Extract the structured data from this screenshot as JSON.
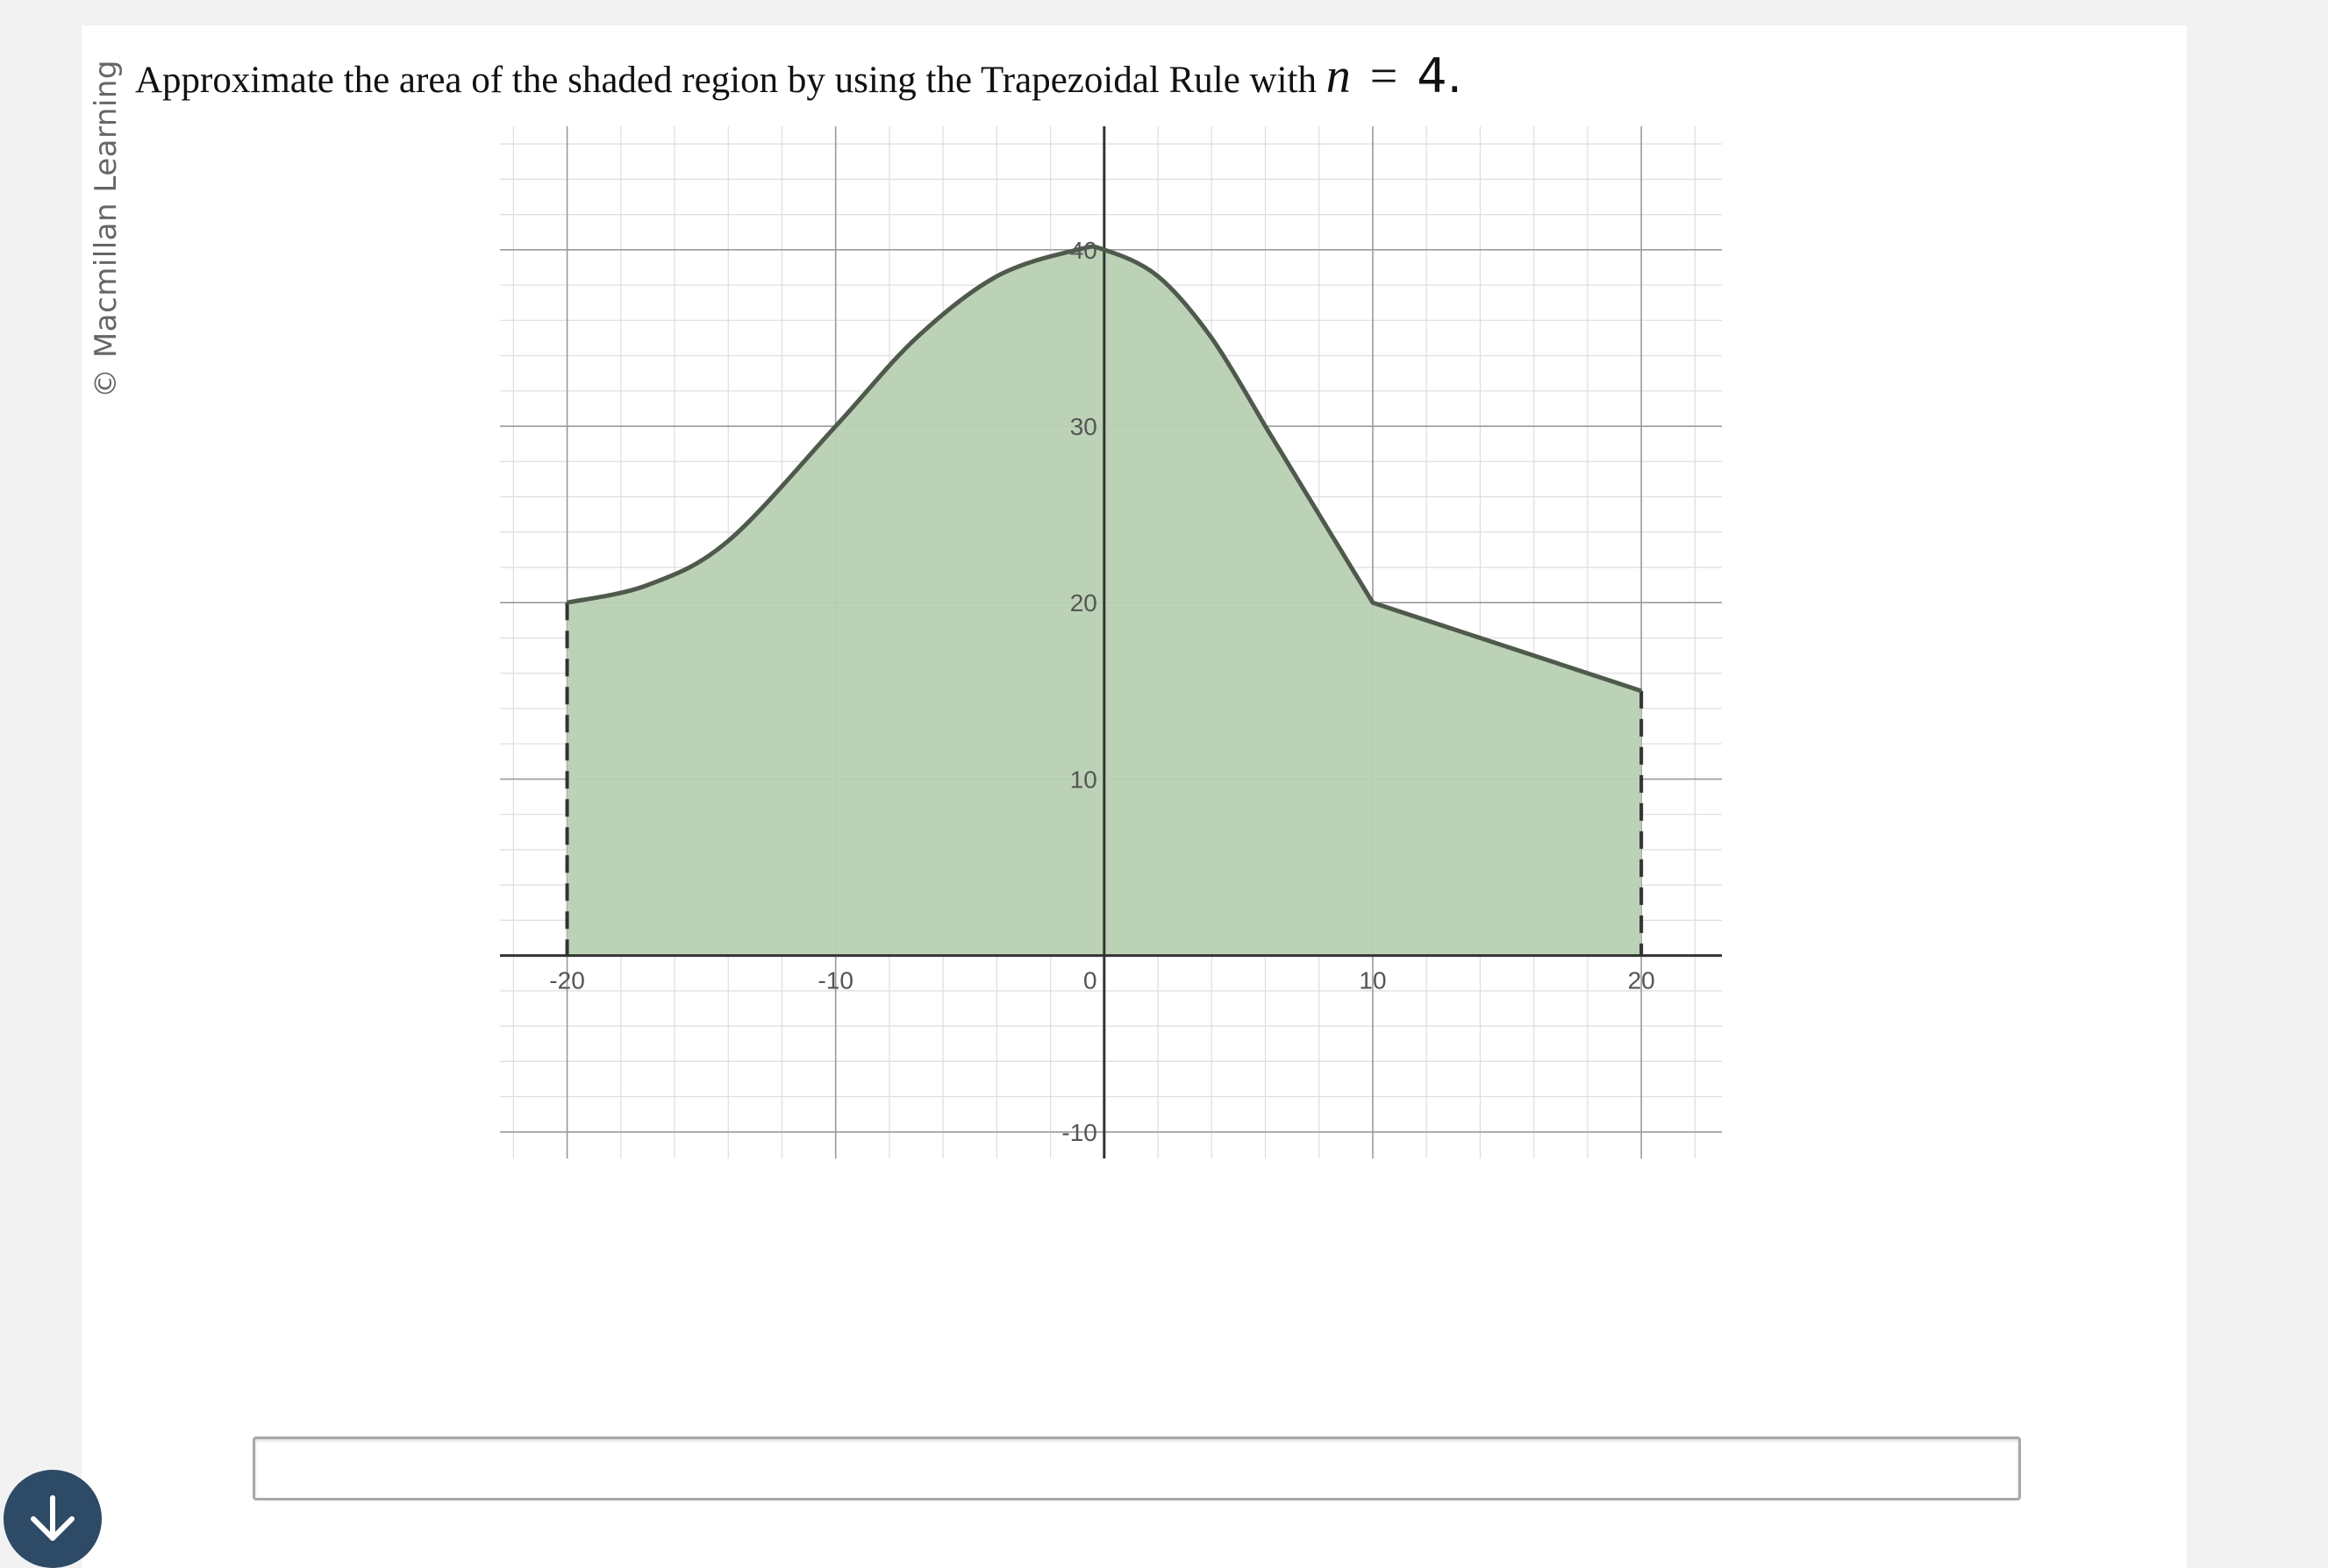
{
  "watermark": "© Macmillan Learning",
  "question": {
    "text": "Approximate the area of the shaded region by using the Trapezoidal Rule with",
    "variable": "n",
    "equals": "=",
    "value": "4."
  },
  "answer": {
    "value": "",
    "placeholder": ""
  },
  "scroll_button_icon": "arrow-down-icon",
  "colors": {
    "fill": "#b8d0b2",
    "curve": "#4f5a4d",
    "scroll_button": "#2d4a66"
  },
  "chart_data": {
    "type": "area",
    "xlim": [
      -22.5,
      23
    ],
    "ylim": [
      -11.5,
      47
    ],
    "grid": true,
    "x_ticks": [
      -20,
      -10,
      0,
      10,
      20
    ],
    "x_tick_labels": [
      "-20",
      "-10",
      "0",
      "10",
      "20"
    ],
    "y_ticks": [
      -10,
      10,
      20,
      30,
      40
    ],
    "y_tick_labels": [
      "-10",
      "10",
      "20",
      "30",
      "40"
    ],
    "curve": [
      {
        "x": -20,
        "y": 20
      },
      {
        "x": -17,
        "y": 21
      },
      {
        "x": -14,
        "y": 23.5
      },
      {
        "x": -10,
        "y": 30
      },
      {
        "x": -7,
        "y": 35
      },
      {
        "x": -4,
        "y": 38.5
      },
      {
        "x": -1,
        "y": 40
      },
      {
        "x": 0,
        "y": 40
      },
      {
        "x": 2,
        "y": 38.5
      },
      {
        "x": 4,
        "y": 35
      },
      {
        "x": 6,
        "y": 30
      },
      {
        "x": 10,
        "y": 20
      },
      {
        "x": 20,
        "y": 15
      }
    ],
    "bounds": [
      {
        "x": -20,
        "y_top": 20
      },
      {
        "x": 20,
        "y_top": 15
      }
    ]
  }
}
